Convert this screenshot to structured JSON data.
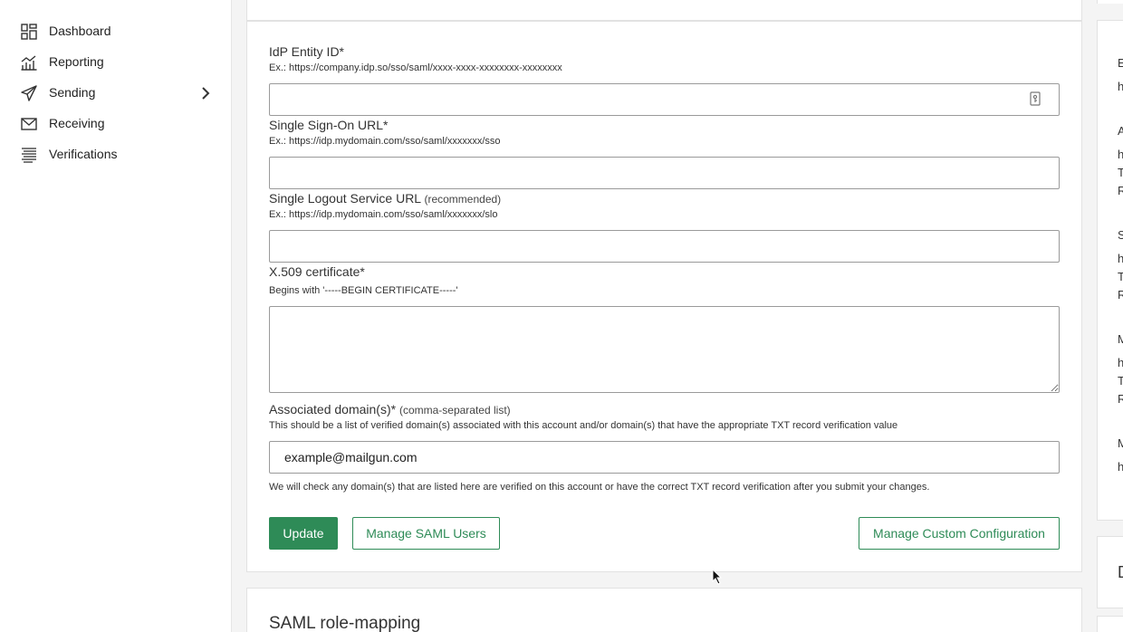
{
  "sidebar": {
    "items": [
      {
        "label": "Dashboard",
        "icon": "dashboard-icon"
      },
      {
        "label": "Reporting",
        "icon": "reporting-icon"
      },
      {
        "label": "Sending",
        "icon": "send-icon"
      },
      {
        "label": "Receiving",
        "icon": "mail-icon"
      },
      {
        "label": "Verifications",
        "icon": "list-icon"
      }
    ]
  },
  "form": {
    "idp_entity": {
      "label": "IdP Entity ID*",
      "hint": "Ex.: https://company.idp.so/sso/saml/xxxx-xxxx-xxxxxxxx-xxxxxxxx",
      "value": ""
    },
    "sso_url": {
      "label": "Single Sign-On URL*",
      "hint": "Ex.: https://idp.mydomain.com/sso/saml/xxxxxxx/sso",
      "value": ""
    },
    "slo_url": {
      "label": "Single Logout Service URL",
      "label_note": "(recommended)",
      "hint": "Ex.: https://idp.mydomain.com/sso/saml/xxxxxxx/slo",
      "value": ""
    },
    "certificate": {
      "label": "X.509 certificate*",
      "hint": "Begins with '-----BEGIN CERTIFICATE-----'",
      "value": ""
    },
    "domains": {
      "label": "Associated domain(s)*",
      "label_note": "(comma-separated list)",
      "hint": "This should be a list of verified domain(s) associated with this account and/or domain(s) that have the appropriate TXT record verification value",
      "value": "example@mailgun.com",
      "footnote": "We will check any domain(s) that are listed here are verified on this account or have the correct TXT record verification after you submit your changes."
    },
    "buttons": {
      "update": "Update",
      "manage_users": "Manage SAML Users",
      "manage_config": "Manage Custom Configuration"
    }
  },
  "role_mapping": {
    "title": "SAML role-mapping"
  },
  "right_panel": {
    "letters": [
      "E",
      "h",
      "A",
      "h",
      "T",
      "R",
      "S",
      "h",
      "T",
      "R",
      "M",
      "h",
      "T",
      "R",
      "M",
      "h"
    ],
    "bottom_letter": "D"
  },
  "colors": {
    "accent": "#2e8b57",
    "background": "#f4f4f4",
    "card": "#ffffff"
  }
}
